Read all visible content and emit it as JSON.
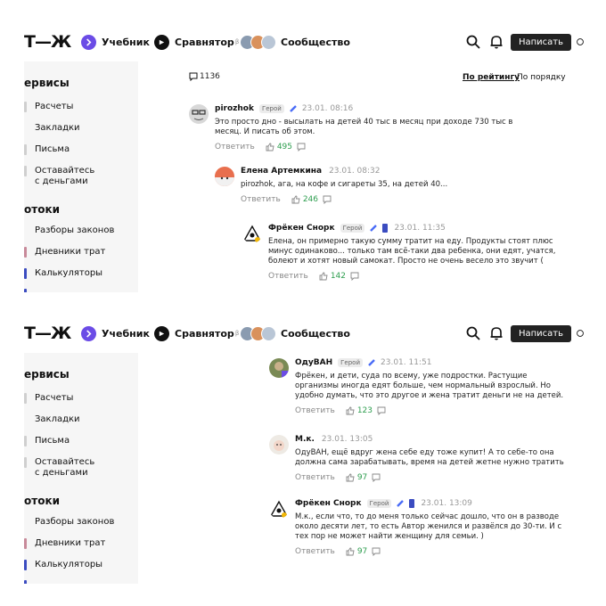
{
  "header": {
    "logo": "Т—Ж",
    "nav": [
      {
        "label": "Учебник",
        "icon": "book-icon"
      },
      {
        "label": "Сравнятор",
        "beta": "β",
        "icon": "compare-icon"
      },
      {
        "label": "Сообщество",
        "icon": "community-avatars"
      }
    ],
    "write_label": "Написать"
  },
  "sidebar": {
    "section1": "ервисы",
    "section1_items": [
      "Расчеты",
      "Закладки",
      "Письма",
      "Оставайтесь\nс деньгами"
    ],
    "section2": "отоки",
    "section2_items": [
      "Разборы законов",
      "Дневники трат",
      "Калькуляторы"
    ]
  },
  "shot1": {
    "comment_count": "1136",
    "sort_rating": "По рейтингу",
    "sort_order": "По порядку",
    "comments": [
      {
        "user": "pirozhok",
        "badge": "Герой",
        "date": "23.01. 08:16",
        "text": "Это просто дно - высылать на детей 40 тыс в месяц при доходе 730 тыс в месяц. И писать об этом.",
        "reply": "Ответить",
        "likes": "495"
      },
      {
        "user": "Елена Артемкина",
        "badge": "",
        "date": "23.01. 08:32",
        "text": "pirozhok, ага, на кофе и сигареты 35, на детей 40...",
        "reply": "Ответить",
        "likes": "246"
      },
      {
        "user": "Фрёкен Снорк",
        "badge": "Герой",
        "date": "23.01. 11:35",
        "text": "Елена, он примерно такую сумму тратит на еду. Продукты стоят плюс минус одинаково... только там всё-таки два ребенка, они едят, учатся, болеют и хотят новый самокат. Просто не очень весело это звучит (",
        "reply": "Ответить",
        "likes": "142"
      }
    ]
  },
  "shot2": {
    "comments": [
      {
        "user": "ОдуВАН",
        "badge": "Герой",
        "date": "23.01. 11:51",
        "text": "Фрёкен, и дети, суда по всему, уже подростки. Растущие организмы иногда едят больше, чем нормальный взрослый. Но удобно думать, что это другое и жена тратит деньги не на детей.",
        "reply": "Ответить",
        "likes": "123"
      },
      {
        "user": "М.к.",
        "badge": "",
        "date": "23.01. 13:05",
        "text": "ОдуВАН, ещё вдруг жена себе еду тоже купит! А то себе-то она должна сама зарабатывать, время на детей жетне нужно тратить",
        "reply": "Ответить",
        "likes": "97"
      },
      {
        "user": "Фрёкен Снорк",
        "badge": "Герой",
        "date": "23.01. 13:09",
        "text": "М.к., если что, то до меня только сейчас дошло, что он в разводе около десяти лет, то есть Автор женился и развёлся до 30-ти. И с тех пор не может найти женщину для семьи. )",
        "reply": "Ответить",
        "likes": "97"
      }
    ]
  },
  "colors": {
    "accent_green": "#2e9e4f",
    "purple": "#6b4ce6",
    "sidebar_bg": "#f6f6f6"
  }
}
